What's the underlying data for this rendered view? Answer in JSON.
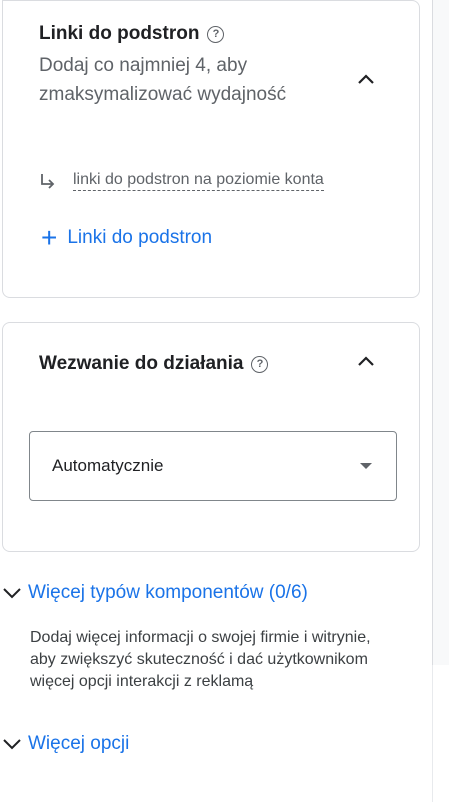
{
  "sitelinks": {
    "title": "Linki do podstron",
    "subtitle": "Dodaj co najmniej 4, aby zmaksymalizować wydajność",
    "account_level_link": "linki do podstron na poziomie konta",
    "add_label": "Linki do podstron"
  },
  "cta": {
    "title": "Wezwanie do działania",
    "select_value": "Automatycznie"
  },
  "more_asset_types": {
    "label": "Więcej typów komponentów (0/6)",
    "description": "Dodaj więcej informacji o swojej firmie i witrynie, aby zwiększyć skuteczność i dać użytkownikom więcej opcji interakcji z reklamą"
  },
  "more_options": {
    "label": "Więcej opcji"
  },
  "icons": {
    "help": "help-circle-icon",
    "collapse": "chevron-up-icon",
    "expand": "chevron-down-icon",
    "subdirectory": "subdirectory-arrow-icon",
    "add": "plus-icon",
    "dropdown": "caret-down-icon"
  },
  "colors": {
    "link": "#1a73e8",
    "text": "#202124",
    "secondary": "#5f6368",
    "border": "#dadce0"
  }
}
